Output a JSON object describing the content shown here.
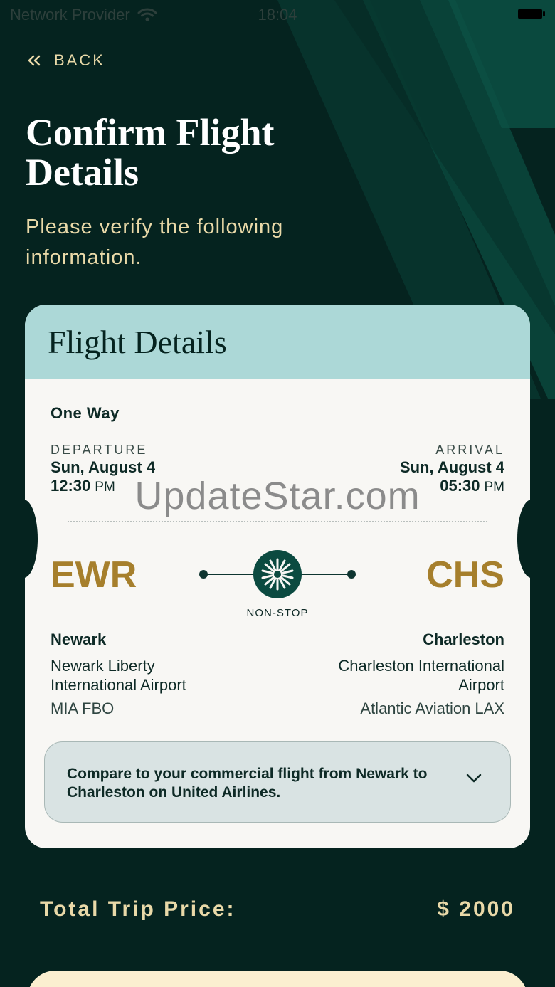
{
  "status_bar": {
    "carrier": "Network Provider",
    "time": "18:04"
  },
  "nav": {
    "back_label": "BACK"
  },
  "page": {
    "title": "Confirm Flight Details",
    "subtitle": "Please verify the following information."
  },
  "card": {
    "title": "Flight Details",
    "trip_type": "One Way",
    "departure": {
      "label": "DEPARTURE",
      "date": "Sun, August 4",
      "time": "12:30",
      "ampm": "PM"
    },
    "arrival": {
      "label": "ARRIVAL",
      "date": "Sun, August 4",
      "time": "05:30",
      "ampm": "PM"
    },
    "watermark": "UpdateStar.com",
    "origin": {
      "code": "EWR",
      "city": "Newark",
      "airport": "Newark Liberty International Airport",
      "fbo": "MIA FBO"
    },
    "destination": {
      "code": "CHS",
      "city": "Charleston",
      "airport": "Charleston International Airport",
      "fbo": "Atlantic Aviation LAX"
    },
    "route_label": "NON-STOP",
    "compare_text": "Compare to your commercial flight from Newark to Charleston on United Airlines."
  },
  "total": {
    "label": "Total Trip Price:",
    "value": "$ 2000"
  },
  "colors": {
    "background": "#05231f",
    "accent_gold": "#a67f2c",
    "cream_text": "#e9d9a8",
    "card_header": "#acd8d7",
    "card_body": "#f8f7f4",
    "compare_box": "#d9e3e3"
  },
  "icons": [
    "wifi-icon",
    "battery-icon",
    "double-chevron-left-icon",
    "airline-logo-icon",
    "chevron-down-icon"
  ]
}
